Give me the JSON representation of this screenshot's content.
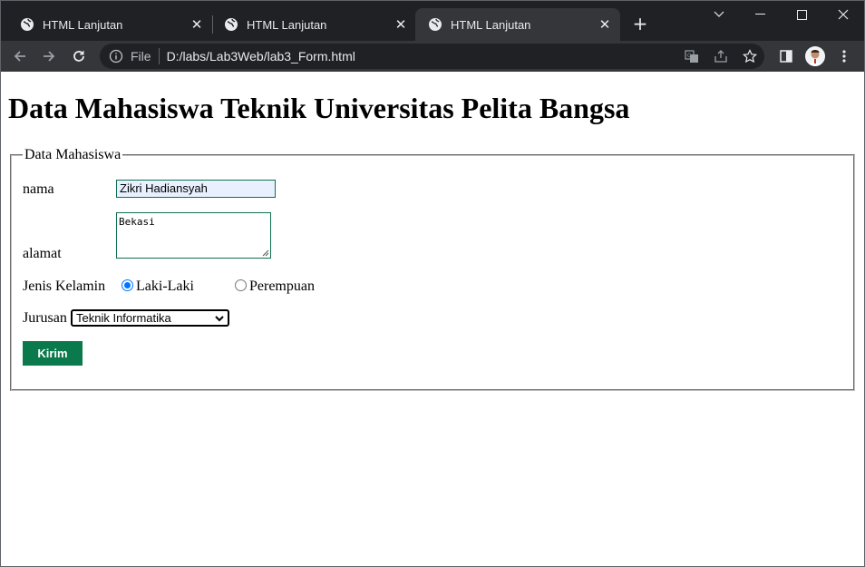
{
  "browser": {
    "tabs": [
      {
        "title": "HTML Lanjutan",
        "active": false
      },
      {
        "title": "HTML Lanjutan",
        "active": false
      },
      {
        "title": "HTML Lanjutan",
        "active": true
      }
    ],
    "new_tab_icon": "plus-icon",
    "address": {
      "scheme_label": "File",
      "url": "D:/labs/Lab3Web/lab3_Form.html"
    },
    "colors": {
      "tabstrip": "#202124",
      "toolbar": "#35363a"
    }
  },
  "page": {
    "heading": "Data Mahasiswa Teknik Universitas Pelita Bangsa",
    "fieldset_legend": "Data Mahasiswa",
    "labels": {
      "nama": "nama",
      "alamat": "alamat",
      "jenis_kelamin": "Jenis Kelamin",
      "jurusan": "Jurusan"
    },
    "fields": {
      "nama_value": "Zikri Hadiansyah",
      "alamat_value": "Bekasi",
      "gender_options": [
        {
          "label": "Laki-Laki",
          "checked": true
        },
        {
          "label": "Perempuan",
          "checked": false
        }
      ],
      "jurusan_selected": "Teknik Informatika"
    },
    "submit_label": "Kirim",
    "colors": {
      "button": "#0a7a4c",
      "radio": "#0075ff",
      "input_border": "#107050"
    }
  }
}
